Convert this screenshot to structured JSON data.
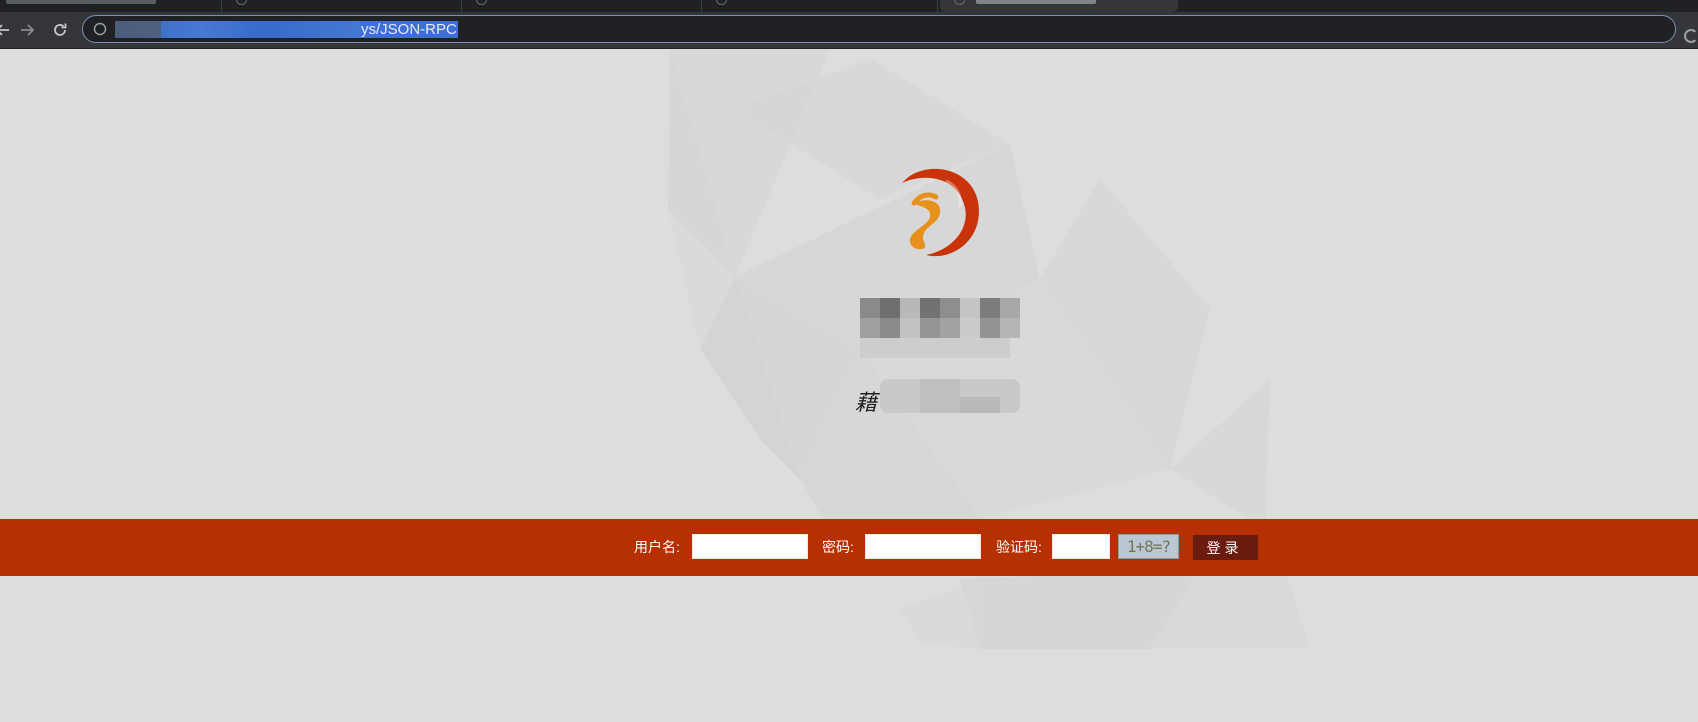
{
  "browser": {
    "url_visible": "ys/JSON-RPC",
    "icons": [
      "back-arrow-icon",
      "forward-arrow-icon",
      "reload-icon",
      "site-info-icon",
      "extension-icon"
    ]
  },
  "login": {
    "username_label": "用户名:",
    "password_label": "密码:",
    "captcha_label": "验证码:",
    "captcha_text": "1+8=?",
    "username_value": "",
    "password_value": "",
    "captcha_value": "",
    "submit_label": "登录"
  },
  "page": {
    "title_partial_char": "藉"
  },
  "colors": {
    "login_bar": "#b53102",
    "login_button": "#6a1d0f",
    "page_background": "#dddddd",
    "logo_red": "#c8330a",
    "logo_orange": "#e8901c"
  }
}
